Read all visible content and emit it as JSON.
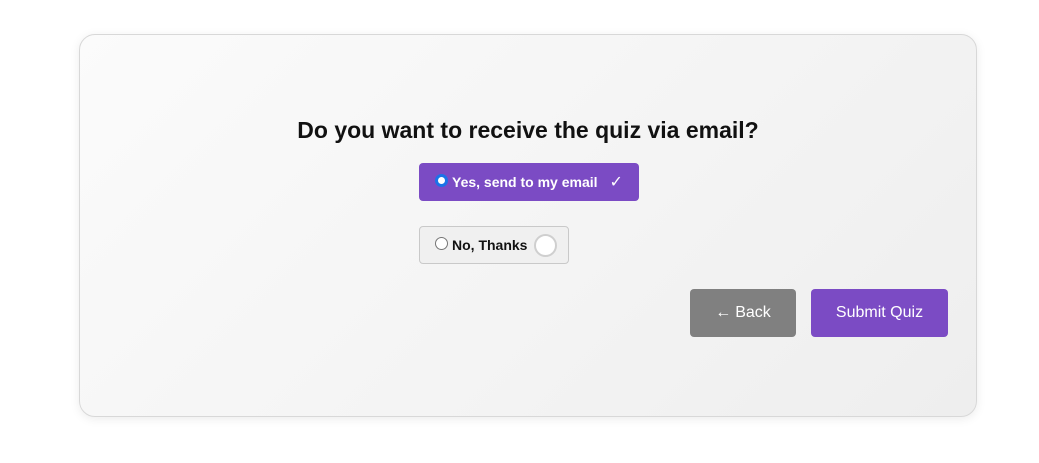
{
  "quiz": {
    "question": "Do you want to receive the quiz via email?",
    "options": [
      {
        "label": "Yes, send to my email",
        "selected": true,
        "indicator": "✓"
      },
      {
        "label": "No, Thanks",
        "selected": false
      }
    ],
    "back_button": {
      "arrow": "←",
      "label": "Back"
    },
    "submit_button": {
      "label": "Submit Quiz"
    }
  },
  "colors": {
    "accent": "#7b4bc4",
    "back_button": "#808080",
    "radio_checked": "#1a73e8"
  }
}
